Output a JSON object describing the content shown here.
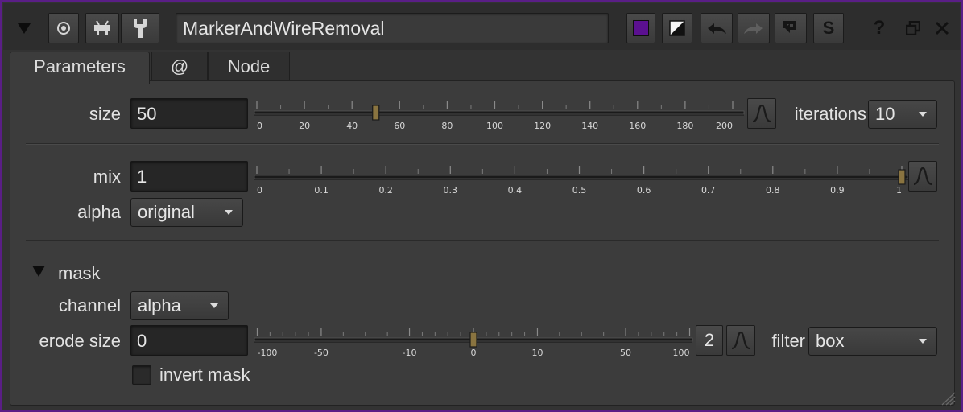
{
  "title_bar": {
    "node_name": "MarkerAndWireRemoval",
    "icons": [
      "collapse-triangle-icon",
      "center-target-icon",
      "viewer-icon",
      "wrench-icon",
      "node-color-swatch",
      "gl-color-icon",
      "undo-icon",
      "redo-icon",
      "revert-icon",
      "simplify-icon",
      "help-icon",
      "float-window-icon",
      "close-icon"
    ],
    "simplify_label": "S",
    "help_label": "?",
    "node_color": "#5b1090"
  },
  "tabs": [
    {
      "label": "Parameters",
      "active": true
    },
    {
      "label": "@",
      "active": false
    },
    {
      "label": "Node",
      "active": false
    }
  ],
  "params": {
    "size": {
      "label": "size",
      "value": "50",
      "slider_min": 0,
      "slider_max": 200,
      "ticks": [
        "0",
        "20",
        "40",
        "60",
        "80",
        "100",
        "120",
        "140",
        "160",
        "180",
        "200"
      ]
    },
    "iterations": {
      "label": "iterations",
      "value": "10"
    },
    "mix": {
      "label": "mix",
      "value": "1",
      "slider_min": 0,
      "slider_max": 1,
      "ticks": [
        "0",
        "0.1",
        "0.2",
        "0.3",
        "0.4",
        "0.5",
        "0.6",
        "0.7",
        "0.8",
        "0.9",
        "1"
      ]
    },
    "alpha": {
      "label": "alpha",
      "value": "original"
    },
    "mask_group": {
      "label": "mask"
    },
    "channel": {
      "label": "channel",
      "value": "alpha"
    },
    "erode_size": {
      "label": "erode size",
      "value": "0",
      "ticks": [
        "-100",
        "-50",
        "-10",
        "0",
        "10",
        "50",
        "100"
      ],
      "dimensions_label": "2"
    },
    "filter": {
      "label": "filter",
      "value": "box"
    },
    "invert_mask": {
      "label": "invert mask",
      "checked": false
    }
  }
}
